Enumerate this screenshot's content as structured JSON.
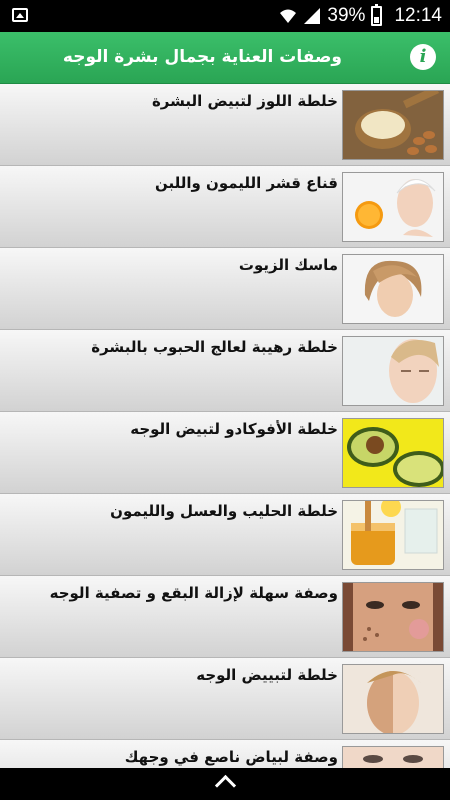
{
  "status_bar": {
    "battery": "39%",
    "time": "12:14"
  },
  "app_bar": {
    "title": "وصفات العناية بجمال بشرة الوجه",
    "info_icon": "info-icon"
  },
  "recipes": [
    {
      "title": "خلطة اللوز لتبيض البشرة",
      "thumb_icon": "almond-image"
    },
    {
      "title": "قناع قشر الليمون واللبن",
      "thumb_icon": "lemon-face-image"
    },
    {
      "title": "ماسك الزيوت",
      "thumb_icon": "woman-portrait-image"
    },
    {
      "title": "خلطة رهيبة لعالج الحبوب بالبشرة",
      "thumb_icon": "woman-face-image"
    },
    {
      "title": "خلطة الأفوكادو لتبيض الوجه",
      "thumb_icon": "avocado-image"
    },
    {
      "title": "خلطة الحليب والعسل والليمون",
      "thumb_icon": "honey-milk-image"
    },
    {
      "title": "وصفة سهلة لإزالة البقع و تصفية الوجه",
      "thumb_icon": "spotted-face-image"
    },
    {
      "title": "خلطة لتبييض الوجه",
      "thumb_icon": "face-half-image"
    },
    {
      "title": "وصفة لبياض ناصع في وجهك",
      "thumb_icon": "eyes-image"
    }
  ],
  "nav": {
    "scroll_up_icon": "chevron-up-icon"
  }
}
